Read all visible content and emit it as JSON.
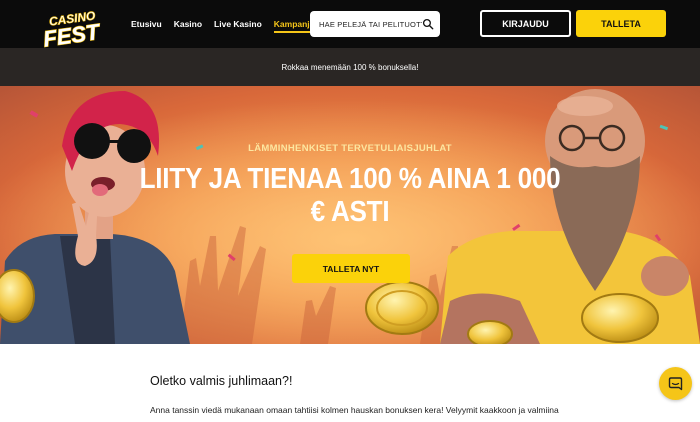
{
  "header": {
    "logo": {
      "top": "CASINO",
      "bottom": "FEST"
    },
    "nav": [
      {
        "label": "Etusivu",
        "active": false
      },
      {
        "label": "Kasino",
        "active": false
      },
      {
        "label": "Live Kasino",
        "active": false
      },
      {
        "label": "Kampanjat",
        "active": true
      }
    ],
    "search": {
      "placeholder": "HAE PELEJÄ TAI PELITUOTTAJ",
      "icon": "search-icon"
    },
    "login_label": "KIRJAUDU",
    "deposit_label": "TALLETA"
  },
  "promo_strip": {
    "text": "Rokkaa menemään 100 % bonuksella!"
  },
  "hero": {
    "eyebrow": "LÄMMINHENKISET TERVETULIAISJUHLAT",
    "title": "LIITY JA TIENAA 100 % AINA 1 000 € ASTI",
    "cta_label": "TALLETA NYT"
  },
  "content": {
    "heading": "Oletko valmis juhlimaan?!",
    "paragraph": "Anna tanssin viedä mukanaan omaan tahtiisi kolmen hauskan bonuksen kera! Velyymit kaakkoon ja valmiina"
  },
  "chat": {
    "icon": "chat-icon"
  },
  "colors": {
    "accent": "#fbd20a",
    "header_bg": "#0b0b0b",
    "strip_bg": "#2a2624",
    "hero_bg": "#ee8a46"
  }
}
